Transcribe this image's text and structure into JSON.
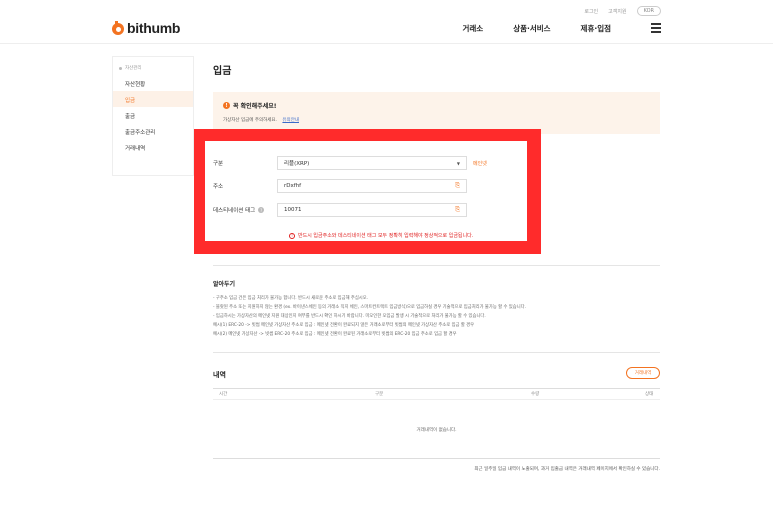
{
  "util": {
    "link1": "로그인",
    "link2": "고객지원",
    "lang": "KOR"
  },
  "header": {
    "logo_text": "bithumb",
    "nav": [
      "거래소",
      "상품·서비스",
      "제휴·입점"
    ],
    "accent": "#f37321"
  },
  "sidebar": {
    "heading": "자산관리",
    "items": [
      {
        "label": "자산현황",
        "active": false
      },
      {
        "label": "입금",
        "active": true
      },
      {
        "label": "출금",
        "active": false
      },
      {
        "label": "출금주소관리",
        "active": false
      },
      {
        "label": "거래내역",
        "active": false
      }
    ]
  },
  "page": {
    "title": "입금"
  },
  "notice": {
    "title": "꼭 확인해주세요!",
    "text": "가상자산 입금에 주의하세요.",
    "link": "유의안내"
  },
  "form": {
    "type_label": "구분",
    "type_value": "리플(XRP)",
    "type_link": "메인넷",
    "address_label": "주소",
    "address_value": "rDxfhf",
    "tag_label": "데스티네이션 태그",
    "tag_value": "10071",
    "warning": "반드시 입금주소와 데스티네이션 태그 모두 정확히 입력해야 정상적으로 입금됩니다.",
    "highlight_color": "#ff2b2b"
  },
  "notes": {
    "title": "알아두기",
    "items": [
      "- 구주소 입금 건은 입금 처리가 불가능 합니다. 반드시 새로운 주소로 입금해 주십시오.",
      "- 블랏된 주소 또는 지원하지 않는 환경 (ex. 바이낸스체인 등의 거래소 직지 체인, 스마트컨트랙트 입금방식)으로 입금하실 경우 기술적으로 입금처리가 불가능 할 수 있습니다.",
      "- 입금하시는 가상자산의 메인넷 지원 대상인지 여부를 반드시 확인 하시기 바랍니다. 미오인한 오입금 발생 시 기술적으로 처리가 불가능 할 수 있습니다.",
      "예시(1) ERC-20 -> 빗썸 메인넷 가상자산 주소로 입금 : 메인넷 전환이 완료되지 않은 거래소로부터 빗썸의 메인넷 가상자산 주소로 입금 할 경우",
      "예시(2) 메인넷 가상자산 -> 빗썸 ERC-20 주소로 입금 : 메인넷 전환이 완료된 거래소로부터 빗썸의 ERC-20 입금 주소로 입금 할 경우"
    ]
  },
  "history": {
    "title": "내역",
    "button": "거래내역",
    "columns": [
      "시간",
      "구분",
      "수량",
      "상태"
    ],
    "empty": "거래내역이 없습니다.",
    "footnote": "최근 일주일 입금 내역이 노출되며, 과거 입출금 내역은 거래내역 페이지에서 확인하실 수 있습니다."
  }
}
